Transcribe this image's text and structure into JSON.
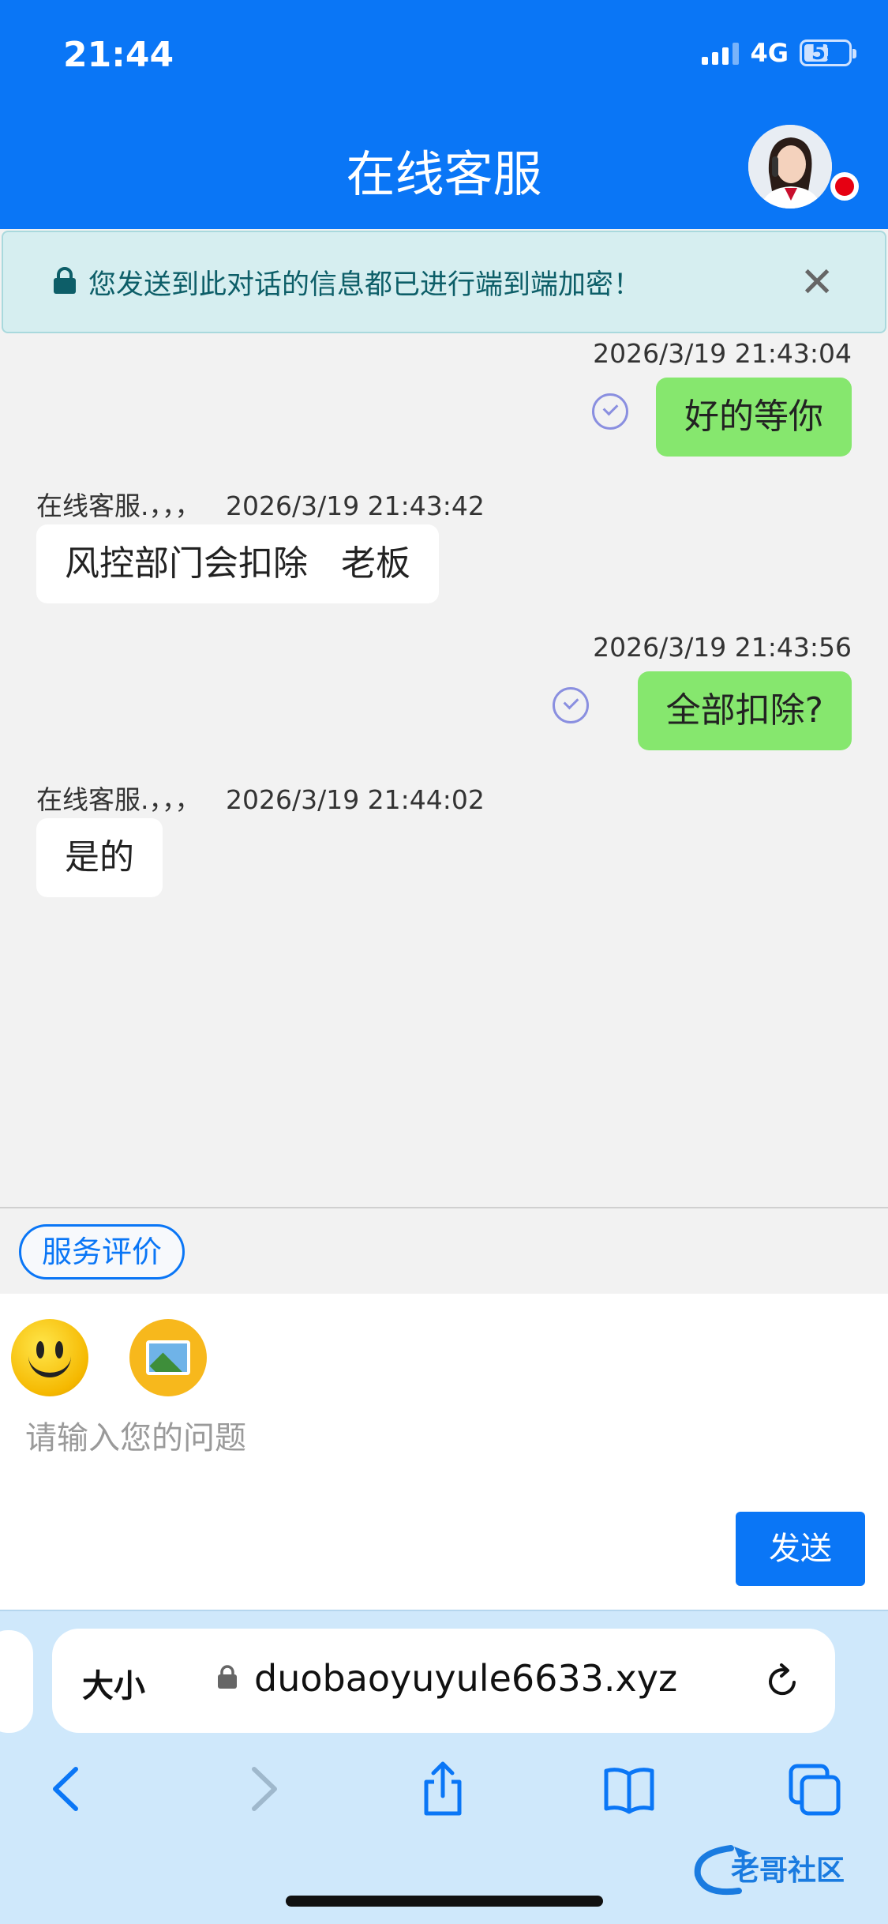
{
  "status": {
    "time": "21:44",
    "network": "4G",
    "battery": "52"
  },
  "header": {
    "title": "在线客服"
  },
  "notice": {
    "text": "您发送到此对话的信息都已进行端到端加密！",
    "close": "✕"
  },
  "messages": [
    {
      "from": "me",
      "timestamp": "2026/3/19 21:43:04",
      "text": "好的等你"
    },
    {
      "from": "agent",
      "sender": "在线客服.，，，",
      "timestamp": "2026/3/19 21:43:42",
      "text": "风控部门会扣除   老板"
    },
    {
      "from": "me",
      "timestamp": "2026/3/19 21:43:56",
      "text": "全部扣除?"
    },
    {
      "from": "agent",
      "sender": "在线客服.，，，",
      "timestamp": "2026/3/19 21:44:02",
      "text": "是的"
    }
  ],
  "rating_button": "服务评价",
  "composer": {
    "placeholder": "请输入您的问题",
    "send_label": "发送"
  },
  "browser": {
    "text_size": "大小",
    "url": "duobaoyuyule6633.xyz",
    "watermark": "老哥社区"
  },
  "colors": {
    "brand": "#0a76f6",
    "my_bubble": "#86e76e",
    "notice_bg": "#d6eef0"
  }
}
